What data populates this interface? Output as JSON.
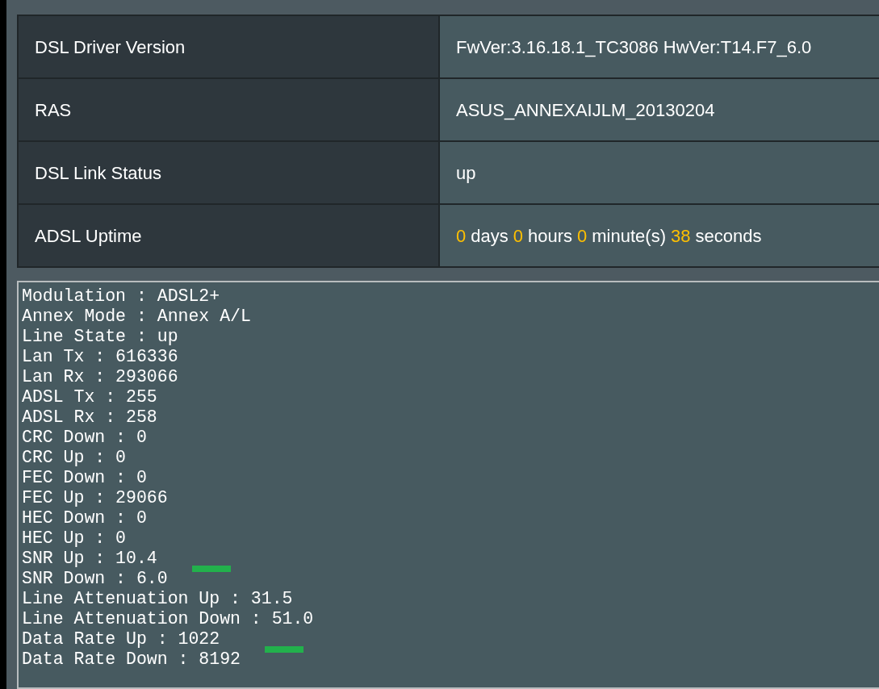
{
  "info_table": {
    "rows": [
      {
        "label": "DSL Driver Version",
        "value": [
          {
            "text": "FwVer:3.16.18.1_TC3086 HwVer:T14.F7_6.0",
            "highlight": false
          }
        ]
      },
      {
        "label": "RAS",
        "value": [
          {
            "text": "ASUS_ANNEXAIJLM_20130204",
            "highlight": false
          }
        ]
      },
      {
        "label": "DSL Link Status",
        "value": [
          {
            "text": "up",
            "highlight": false
          }
        ]
      },
      {
        "label": "ADSL Uptime",
        "value": [
          {
            "text": "0",
            "highlight": true
          },
          {
            "text": "days",
            "highlight": false
          },
          {
            "text": "0",
            "highlight": true
          },
          {
            "text": "hours",
            "highlight": false
          },
          {
            "text": "0",
            "highlight": true
          },
          {
            "text": "minute(s)",
            "highlight": false
          },
          {
            "text": "38",
            "highlight": true
          },
          {
            "text": "seconds",
            "highlight": false
          }
        ]
      }
    ]
  },
  "log": {
    "lines": [
      {
        "text": "Modulation : ADSL2+",
        "marked": false
      },
      {
        "text": "Annex Mode : Annex A/L",
        "marked": false
      },
      {
        "text": "Line State : up",
        "marked": false
      },
      {
        "text": "Lan Tx : 616336",
        "marked": false
      },
      {
        "text": "Lan Rx : 293066",
        "marked": false
      },
      {
        "text": "ADSL Tx : 255",
        "marked": false
      },
      {
        "text": "ADSL Rx : 258",
        "marked": false
      },
      {
        "text": "CRC Down : 0",
        "marked": false
      },
      {
        "text": "CRC Up : 0",
        "marked": false
      },
      {
        "text": "FEC Down : 0",
        "marked": false
      },
      {
        "text": "FEC Up : 29066",
        "marked": false
      },
      {
        "text": "HEC Down : 0",
        "marked": false
      },
      {
        "text": "HEC Up : 0",
        "marked": false
      },
      {
        "text": "SNR Up : 10.4",
        "marked": false
      },
      {
        "text": "SNR Down : 6.0",
        "marked": true
      },
      {
        "text": "Line Attenuation Up : 31.5",
        "marked": false
      },
      {
        "text": "Line Attenuation Down : 51.0",
        "marked": false
      },
      {
        "text": "Data Rate Up : 1022",
        "marked": false
      },
      {
        "text": "Data Rate Down : 8192",
        "marked": true
      }
    ]
  }
}
